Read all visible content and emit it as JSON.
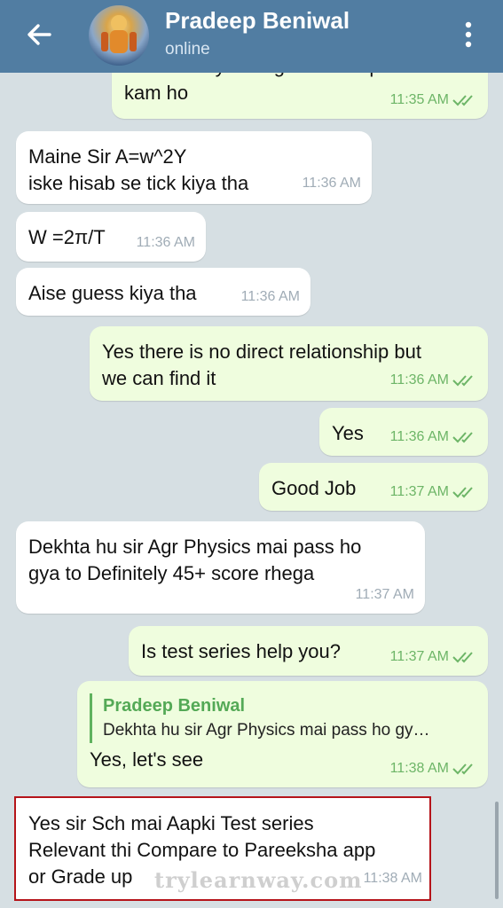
{
  "header": {
    "contact_name": "Pradeep Beniwal",
    "status": "online"
  },
  "messages": [
    {
      "dir": "out",
      "lines": [
        "Aur velocity badegi toh time period",
        "kam ho"
      ],
      "time": "11:35 AM",
      "read": true
    },
    {
      "dir": "in",
      "lines": [
        "Maine Sir A=w^2Y",
        "iske hisab se tick kiya tha"
      ],
      "time": "11:36 AM"
    },
    {
      "dir": "in",
      "lines": [
        "W =2π/T"
      ],
      "time": "11:36 AM"
    },
    {
      "dir": "in",
      "lines": [
        "Aise guess kiya tha"
      ],
      "time": "11:36 AM"
    },
    {
      "dir": "out",
      "lines": [
        "Yes there is no direct relationship but",
        "we can find it"
      ],
      "time": "11:36 AM",
      "read": true
    },
    {
      "dir": "out",
      "lines": [
        "Yes"
      ],
      "time": "11:36 AM",
      "read": true
    },
    {
      "dir": "out",
      "lines": [
        "Good Job"
      ],
      "time": "11:37 AM",
      "read": true
    },
    {
      "dir": "in",
      "lines": [
        "Dekhta hu sir Agr Physics mai pass ho",
        "gya to Definitely 45+ score rhega"
      ],
      "time": "11:37 AM"
    },
    {
      "dir": "out",
      "lines": [
        "Is test series help you?"
      ],
      "time": "11:37 AM",
      "read": true
    },
    {
      "dir": "out",
      "reply_to": {
        "name": "Pradeep Beniwal",
        "text": "Dekhta hu sir Agr Physics mai pass ho gy…"
      },
      "lines": [
        "Yes, let's see"
      ],
      "time": "11:38 AM",
      "read": true
    },
    {
      "dir": "in",
      "lines": [
        "Yes sir Sch mai Aapki Test series",
        "Relevant thi Compare to Pareeksha app",
        "or Grade up"
      ],
      "time": "11:38 AM"
    }
  ],
  "watermark": "trylearnway.com",
  "colors": {
    "header": "#517da2",
    "incoming_bubble": "#ffffff",
    "outgoing_bubble": "#effdde",
    "read_ticks": "#6db567",
    "highlight_border": "#b5141a"
  },
  "icons": [
    "back-arrow-icon",
    "more-vert-icon",
    "double-check-icon"
  ]
}
